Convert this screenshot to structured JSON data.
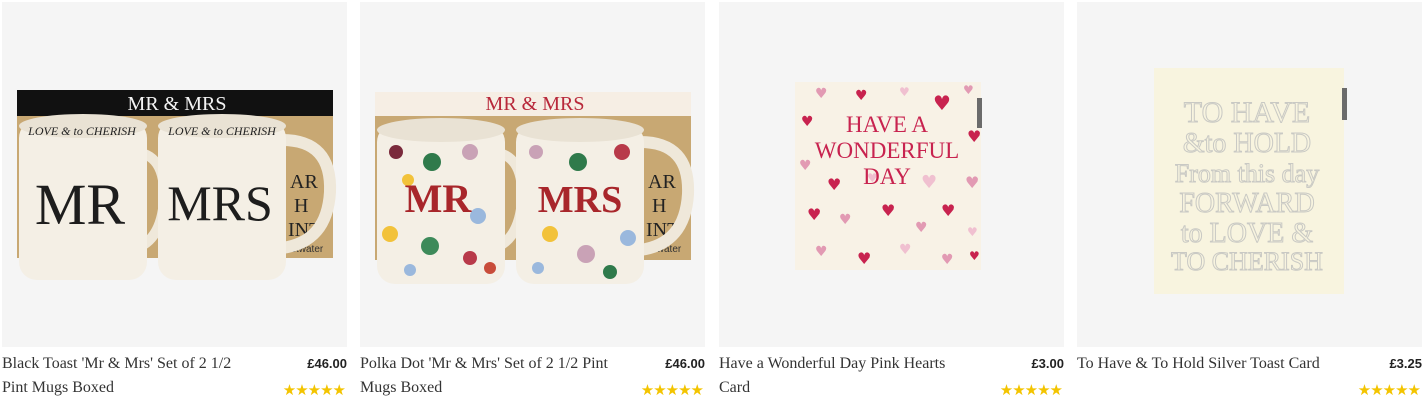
{
  "products": [
    {
      "name": "Black Toast 'Mr & Mrs' Set of 2 1/2 Pint Mugs Boxed",
      "price": "£46.00",
      "rating": 5,
      "stars": "★★★★★",
      "image": {
        "box_lid": "MR & MRS",
        "box_side": [
          "AR",
          "H",
          "INT",
          "stwater"
        ],
        "mug_left": "MR",
        "mug_right": "MRS",
        "rim_text": "LOVE & to CHERISH"
      }
    },
    {
      "name": "Polka Dot 'Mr & Mrs' Set of 2 1/2 Pint Mugs Boxed",
      "price": "£46.00",
      "rating": 5,
      "stars": "★★★★★",
      "image": {
        "box_lid": "MR & MRS",
        "box_side": [
          "AR",
          "H",
          "INT",
          "stwater"
        ],
        "mug_left": "MR",
        "mug_right": "MRS"
      }
    },
    {
      "name": "Have a Wonderful Day Pink Hearts Card",
      "price": "£3.00",
      "rating": 5,
      "stars": "★★★★★",
      "image": {
        "lines": [
          "HAVE A",
          "WONDERFUL",
          "DAY"
        ]
      }
    },
    {
      "name": "To Have & To Hold Silver Toast Card",
      "price": "£3.25",
      "rating": 5,
      "stars": "★★★★★",
      "image": {
        "lines": [
          "TO HAVE",
          "&to HOLD",
          "From this day",
          "FORWARD",
          "to LOVE &",
          "TO CHERISH"
        ]
      }
    }
  ],
  "colors": {
    "star": "#f3c400",
    "tile_bg": "#f5f5f5",
    "kraft": "#c8a873",
    "heart_pink": "#d6336c",
    "mr_red": "#a8262b"
  }
}
